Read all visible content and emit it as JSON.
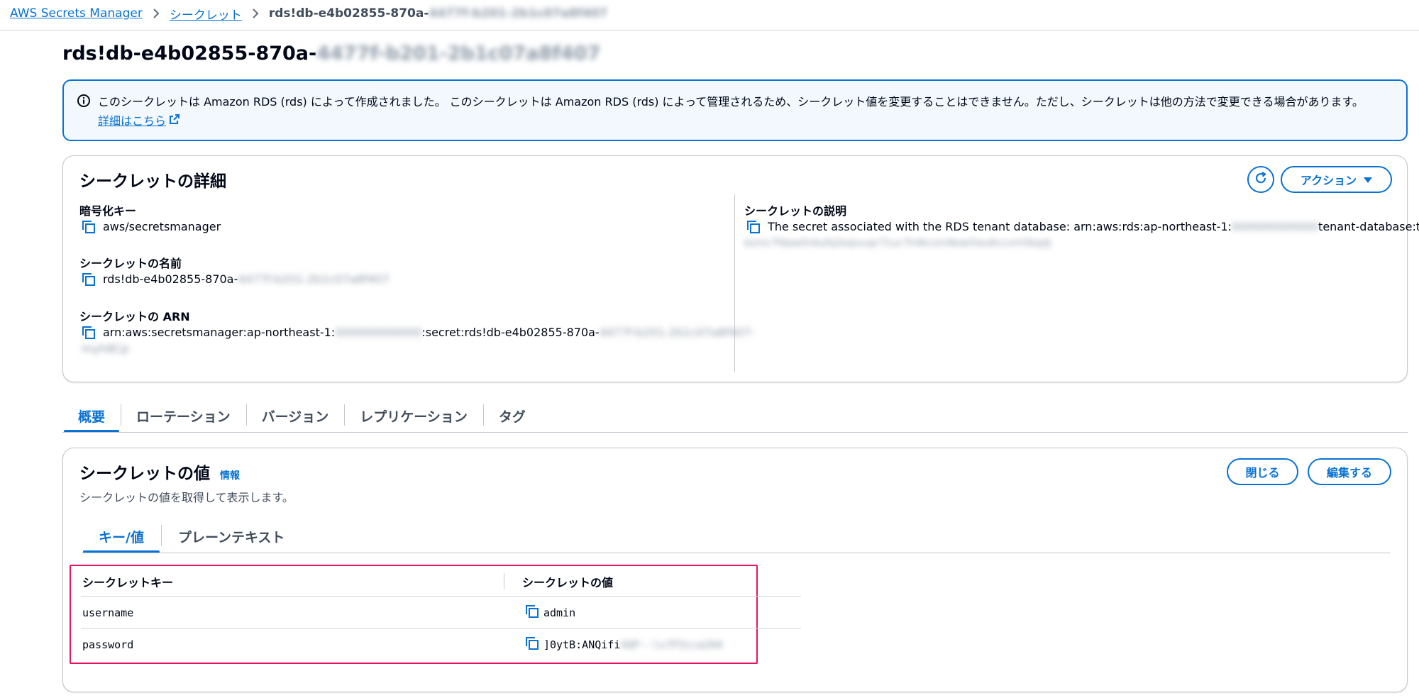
{
  "breadcrumb": {
    "items": [
      "AWS Secrets Manager",
      "シークレット"
    ],
    "current_prefix": "rds!db-e4b02855-870a-",
    "current_redacted": "4477f-b201-2b1c07a8f407"
  },
  "page": {
    "title_prefix": "rds!db-e4b02855-870a-",
    "title_redacted": "4477f-b201-2b1c07a8f407"
  },
  "banner": {
    "text": "このシークレットは Amazon RDS (rds) によって作成されました。 このシークレットは Amazon RDS (rds) によって管理されるため、シークレット値を変更することはできません。ただし、シークレットは他の方法で変更できる場合があります。",
    "link": "詳細はこちら"
  },
  "details": {
    "heading": "シークレットの詳細",
    "actions_label": "アクション",
    "encryption_key_label": "暗号化キー",
    "encryption_key_value": "aws/secretsmanager",
    "name_label": "シークレットの名前",
    "name_prefix": "rds!db-e4b02855-870a-",
    "name_redacted": "4477f-b201-2b1c07a8f407",
    "arn_label": "シークレットの ARN",
    "arn_part1": "arn:aws:secretsmanager:ap-northeast-1:",
    "arn_account_redacted": "000000000000",
    "arn_part2": ":secret:rds!db-e4b02855-870a-",
    "arn_tail_redacted": "4477f-b201-2b1c07a8f407-",
    "arn_line2_redacted": "myh8Cp",
    "description_label": "シークレットの説明",
    "description_part1": "The secret associated with the RDS tenant database: arn:aws:rds:ap-northeast-1:",
    "description_account_redacted": "000000000000",
    "description_part2": "tenant-database:tdb-",
    "description_line2_redacted": "bzmc7fdaw5nkufq3sqivuqr71uc7h4kcsm9ewi5eu6ccvm5bqdj"
  },
  "tabs": [
    "概要",
    "ローテーション",
    "バージョン",
    "レプリケーション",
    "タグ"
  ],
  "secret_value": {
    "heading": "シークレットの値",
    "info_link": "情報",
    "description": "シークレットの値を取得して表示します。",
    "close_button": "閉じる",
    "edit_button": "編集する",
    "inner_tabs": [
      "キー/値",
      "プレーンテキスト"
    ],
    "col_key": "シークレットキー",
    "col_value": "シークレットの値",
    "rows": [
      {
        "key": "username",
        "value": "admin",
        "value_redacted": ""
      },
      {
        "key": "password",
        "value": "]0ytB:ANQifi",
        "value_redacted": "XQP--lx7P3ica2H4"
      }
    ]
  },
  "colors": {
    "accent": "#0972d3",
    "highlight_border": "#e4145f",
    "banner_bg": "#f2f8fd"
  }
}
